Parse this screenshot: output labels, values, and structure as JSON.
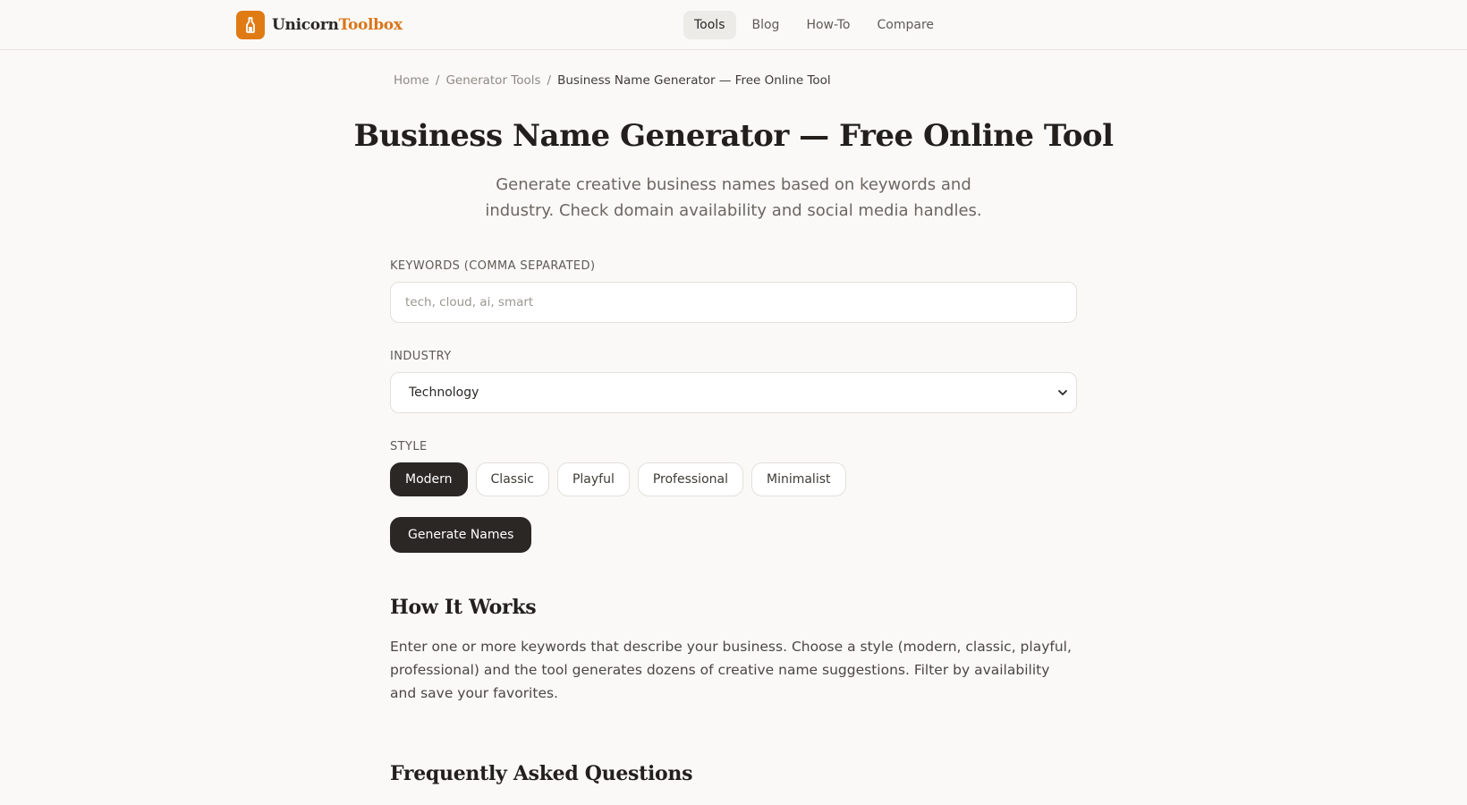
{
  "header": {
    "logo_part1": "Unicorn",
    "logo_part2": "Toolbox",
    "nav": [
      {
        "label": "Tools",
        "active": true
      },
      {
        "label": "Blog",
        "active": false
      },
      {
        "label": "How-To",
        "active": false
      },
      {
        "label": "Compare",
        "active": false
      }
    ]
  },
  "breadcrumb": {
    "home": "Home",
    "sep": "/",
    "category": "Generator Tools",
    "current": "Business Name Generator — Free Online Tool"
  },
  "page": {
    "title": "Business Name Generator — Free Online Tool",
    "subtitle": "Generate creative business names based on keywords and industry. Check domain availability and social media handles."
  },
  "form": {
    "keywords_label": "Keywords (comma separated)",
    "keywords_placeholder": "tech, cloud, ai, smart",
    "keywords_value": "",
    "industry_label": "Industry",
    "industry_value": "Technology",
    "style_label": "Style",
    "styles": [
      "Modern",
      "Classic",
      "Playful",
      "Professional",
      "Minimalist"
    ],
    "selected_style": "Modern",
    "generate_label": "Generate Names"
  },
  "how": {
    "title": "How It Works",
    "body": "Enter one or more keywords that describe your business. Choose a style (modern, classic, playful, professional) and the tool generates dozens of creative name suggestions. Filter by availability and save your favorites."
  },
  "faq": {
    "title": "Frequently Asked Questions"
  },
  "colors": {
    "brand_orange": "#e07b14",
    "dark": "#2a2725",
    "background": "#faf9f7"
  },
  "icons": {
    "logo": "unicorn-bottle-icon",
    "select": "chevron-down-icon"
  }
}
